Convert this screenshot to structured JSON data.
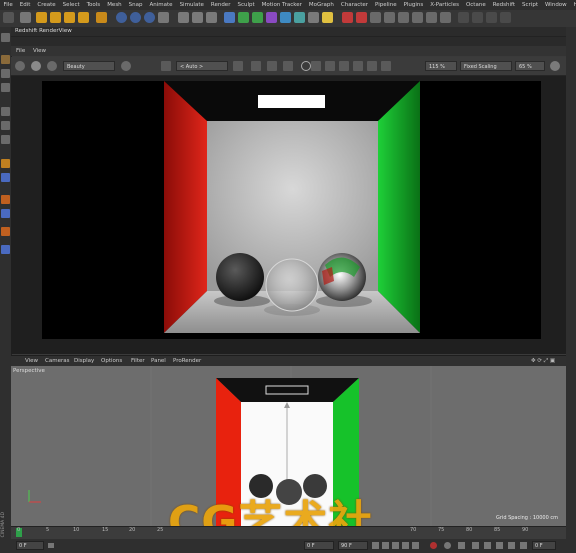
{
  "menubar": [
    "File",
    "Edit",
    "Create",
    "Select",
    "Tools",
    "Mesh",
    "Snap",
    "Animate",
    "Simulate",
    "Render",
    "Sculpt",
    "Motion Tracker",
    "MoGraph",
    "Character",
    "Pipeline",
    "Plugins",
    "X-Particles",
    "Octane",
    "Redshift",
    "Script",
    "Window",
    "He"
  ],
  "renderview": {
    "title": "Redshift RenderView",
    "menu": [
      "File",
      "View"
    ],
    "aov": "Beauty",
    "camera": "< Auto >",
    "zoom": "115 %",
    "scaling": "Fixed Scaling",
    "scale_percent": "65 %"
  },
  "viewport": {
    "menu": [
      "View",
      "Cameras",
      "Display",
      "Options",
      "Filter",
      "Panel",
      "ProRender"
    ],
    "label": "Perspective",
    "grid_spacing": "Grid Spacing : 10000 cm"
  },
  "timeline": {
    "ticks": [
      "0",
      "5",
      "10",
      "15",
      "20",
      "25",
      "70",
      "75",
      "80",
      "85",
      "90"
    ],
    "start_field": "0 F",
    "mid_field_a": "0 F",
    "mid_field_b": "90 F",
    "end_field": "0 F"
  },
  "watermark": "CG艺术社",
  "side_label": "CINEMA 4D",
  "colors": {
    "accent_orange": "#e9a40e",
    "wall_red": "#d21a10",
    "wall_green": "#12b02a"
  }
}
